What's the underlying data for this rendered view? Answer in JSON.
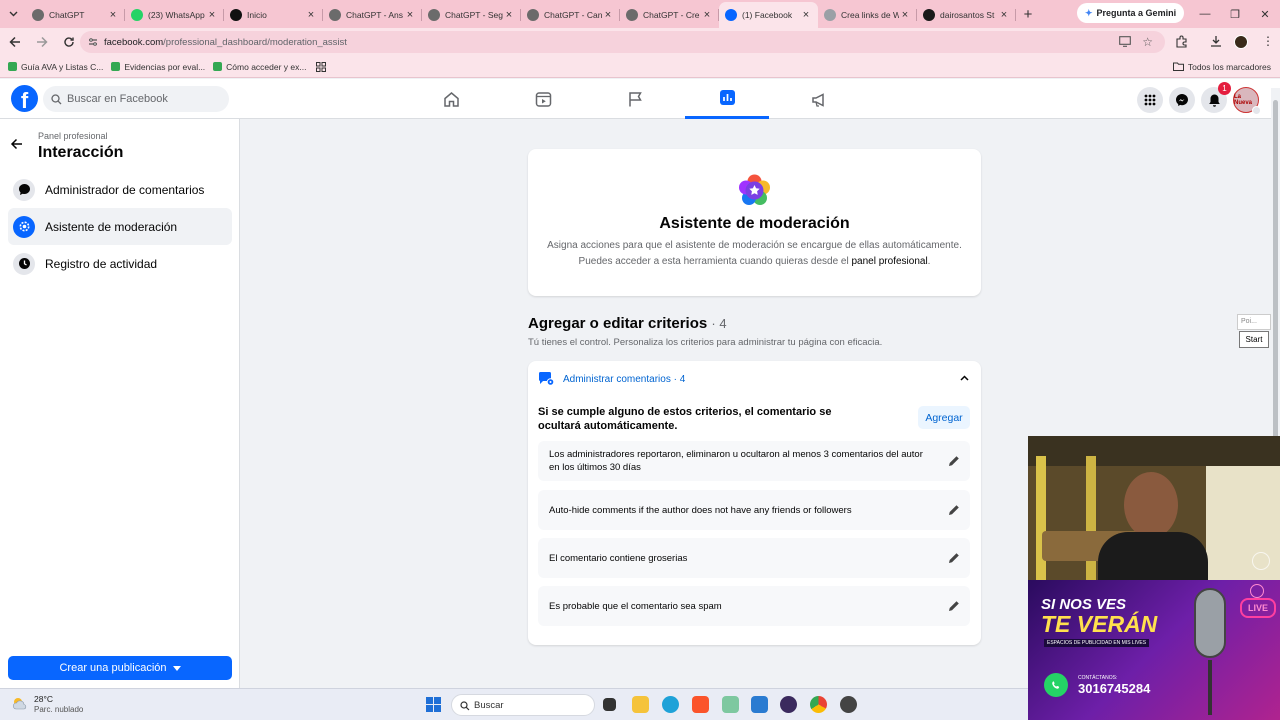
{
  "browser": {
    "tabs": [
      {
        "title": "ChatGPT",
        "color": "#6b6b6b"
      },
      {
        "title": "(23) WhatsApp",
        "color": "#25d366"
      },
      {
        "title": "Inicio",
        "color": "#111111"
      },
      {
        "title": "ChatGPT - Ans",
        "color": "#6b6b6b"
      },
      {
        "title": "ChatGPT - Seg",
        "color": "#6b6b6b"
      },
      {
        "title": "ChatGPT - Can",
        "color": "#6b6b6b"
      },
      {
        "title": "ChatGPT - Cre",
        "color": "#6b6b6b"
      },
      {
        "title": "(1) Facebook",
        "color": "#0866ff"
      },
      {
        "title": "Crea links de W",
        "color": "#9aa0a6"
      },
      {
        "title": "dairosantos St",
        "color": "#1a1a1a"
      }
    ],
    "gemini_label": "Pregunta a Gemini",
    "url_host": "facebook.com",
    "url_path": "/professional_dashboard/moderation_assist",
    "bookmarks": [
      "Guía AVA y Listas C...",
      "Evidencias por eval...",
      "Cómo acceder y ex..."
    ],
    "all_bookmarks": "Todos los marcadores"
  },
  "facebook": {
    "search_placeholder": "Buscar en Facebook",
    "notification_count": "1",
    "avatar_text": "La Nueva"
  },
  "sidebar": {
    "subtitle": "Panel profesional",
    "title": "Interacción",
    "items": [
      {
        "label": "Administrador de comentarios"
      },
      {
        "label": "Asistente de moderación"
      },
      {
        "label": "Registro de actividad"
      }
    ],
    "create_button": "Crear una publicación"
  },
  "hero": {
    "title": "Asistente de moderación",
    "desc_line1": "Asigna acciones para que el asistente de moderación se encargue de ellas automáticamente.",
    "desc_line2_pre": "Puedes acceder a esta herramienta cuando quieras desde el ",
    "desc_link": "panel profesional",
    "desc_line2_post": "."
  },
  "criteria": {
    "title": "Agregar o editar criterios",
    "count": "· 4",
    "description": "Tú tienes el control. Personaliza los criterios para administrar tu página con eficacia.",
    "group_title": "Administrar comentarios · 4",
    "rule": "Si se cumple alguno de estos criterios, el comentario se ocultará automáticamente.",
    "add_button": "Agregar",
    "rows": [
      {
        "text": "Los administradores reportaron, eliminaron u ocultaron al menos 3 comentarios del autor en los últimos 30 días"
      },
      {
        "text": "Auto-hide comments if the author does not have any friends or followers"
      },
      {
        "text": "El comentario contiene groserias"
      },
      {
        "text": "Es probable que el comentario sea spam"
      }
    ]
  },
  "overlay": {
    "popup_text": "Poi...",
    "start_label": "Start",
    "ad_line1": "SI NOS VES",
    "ad_line2": "TE VERÁN",
    "ad_sub": "ESPACIOS DE PUBLICIDAD EN MIS LIVES",
    "ad_contact_label": "CONTÁCTANOS:",
    "ad_phone": "3016745284",
    "ad_live": "LIVE"
  },
  "taskbar": {
    "temperature": "28°C",
    "weather": "Parc. nublado",
    "search": "Buscar"
  }
}
